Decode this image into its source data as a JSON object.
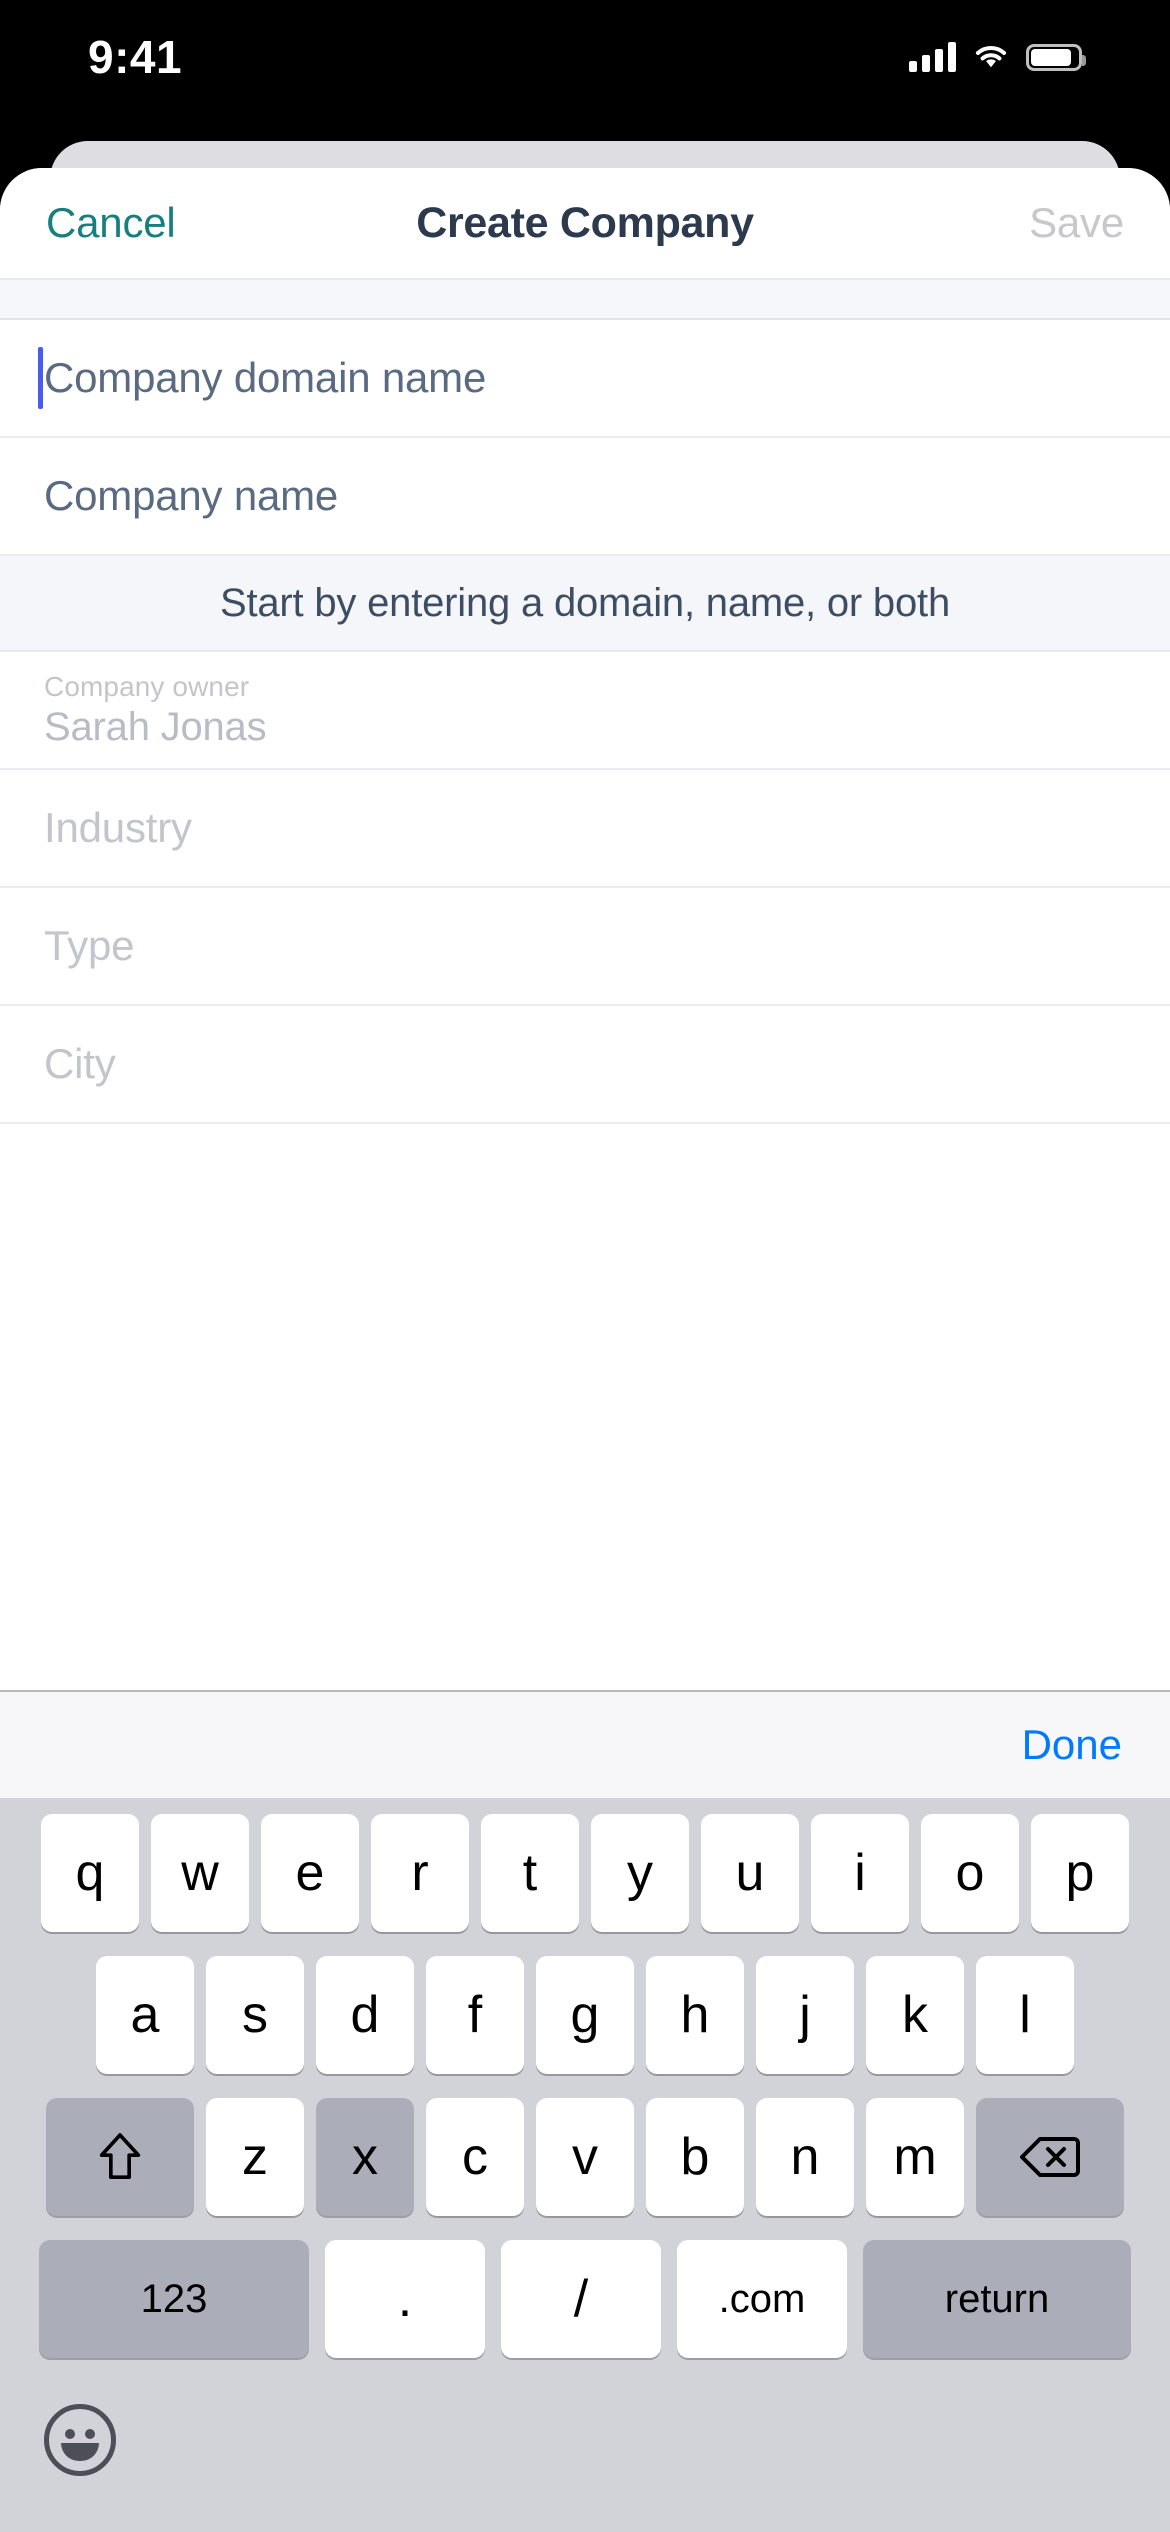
{
  "status_bar": {
    "time": "9:41",
    "cellular_icon": "cellular-bars-icon",
    "wifi_icon": "wifi-icon",
    "battery_icon": "battery-icon"
  },
  "nav": {
    "cancel_label": "Cancel",
    "title": "Create Company",
    "save_label": "Save",
    "cancel_color": "#17807e",
    "title_color": "#2d3a4e",
    "save_color": "#c7c7cc"
  },
  "form": {
    "fields": [
      {
        "placeholder": "Company domain name",
        "value": "",
        "state": "focused",
        "label": ""
      },
      {
        "placeholder": "Company name",
        "value": "",
        "state": "empty",
        "label": ""
      }
    ],
    "hint": "Start by entering a domain, name, or both",
    "owner": {
      "label": "Company owner",
      "value": "Sarah Jonas"
    },
    "more_fields": [
      {
        "placeholder": "Industry"
      },
      {
        "placeholder": "Type"
      },
      {
        "placeholder": "City"
      }
    ]
  },
  "accessory": {
    "done_label": "Done",
    "done_color": "#007aff"
  },
  "keyboard": {
    "type": "url",
    "row1": [
      "q",
      "w",
      "e",
      "r",
      "t",
      "y",
      "u",
      "i",
      "o",
      "p"
    ],
    "row2": [
      "a",
      "s",
      "d",
      "f",
      "g",
      "h",
      "j",
      "k",
      "l"
    ],
    "row3": [
      "z",
      "x",
      "c",
      "v",
      "b",
      "n",
      "m"
    ],
    "shift_icon": "shift-arrow-up-icon",
    "backspace_icon": "backspace-delete-icon",
    "row4": {
      "numbers_label": "123",
      "period_label": ".",
      "slash_label": "/",
      "dotcom_label": ".com",
      "return_label": "return"
    },
    "emoji_icon": "emoji-smiley-icon",
    "highlighted_keys": [
      "x"
    ]
  }
}
